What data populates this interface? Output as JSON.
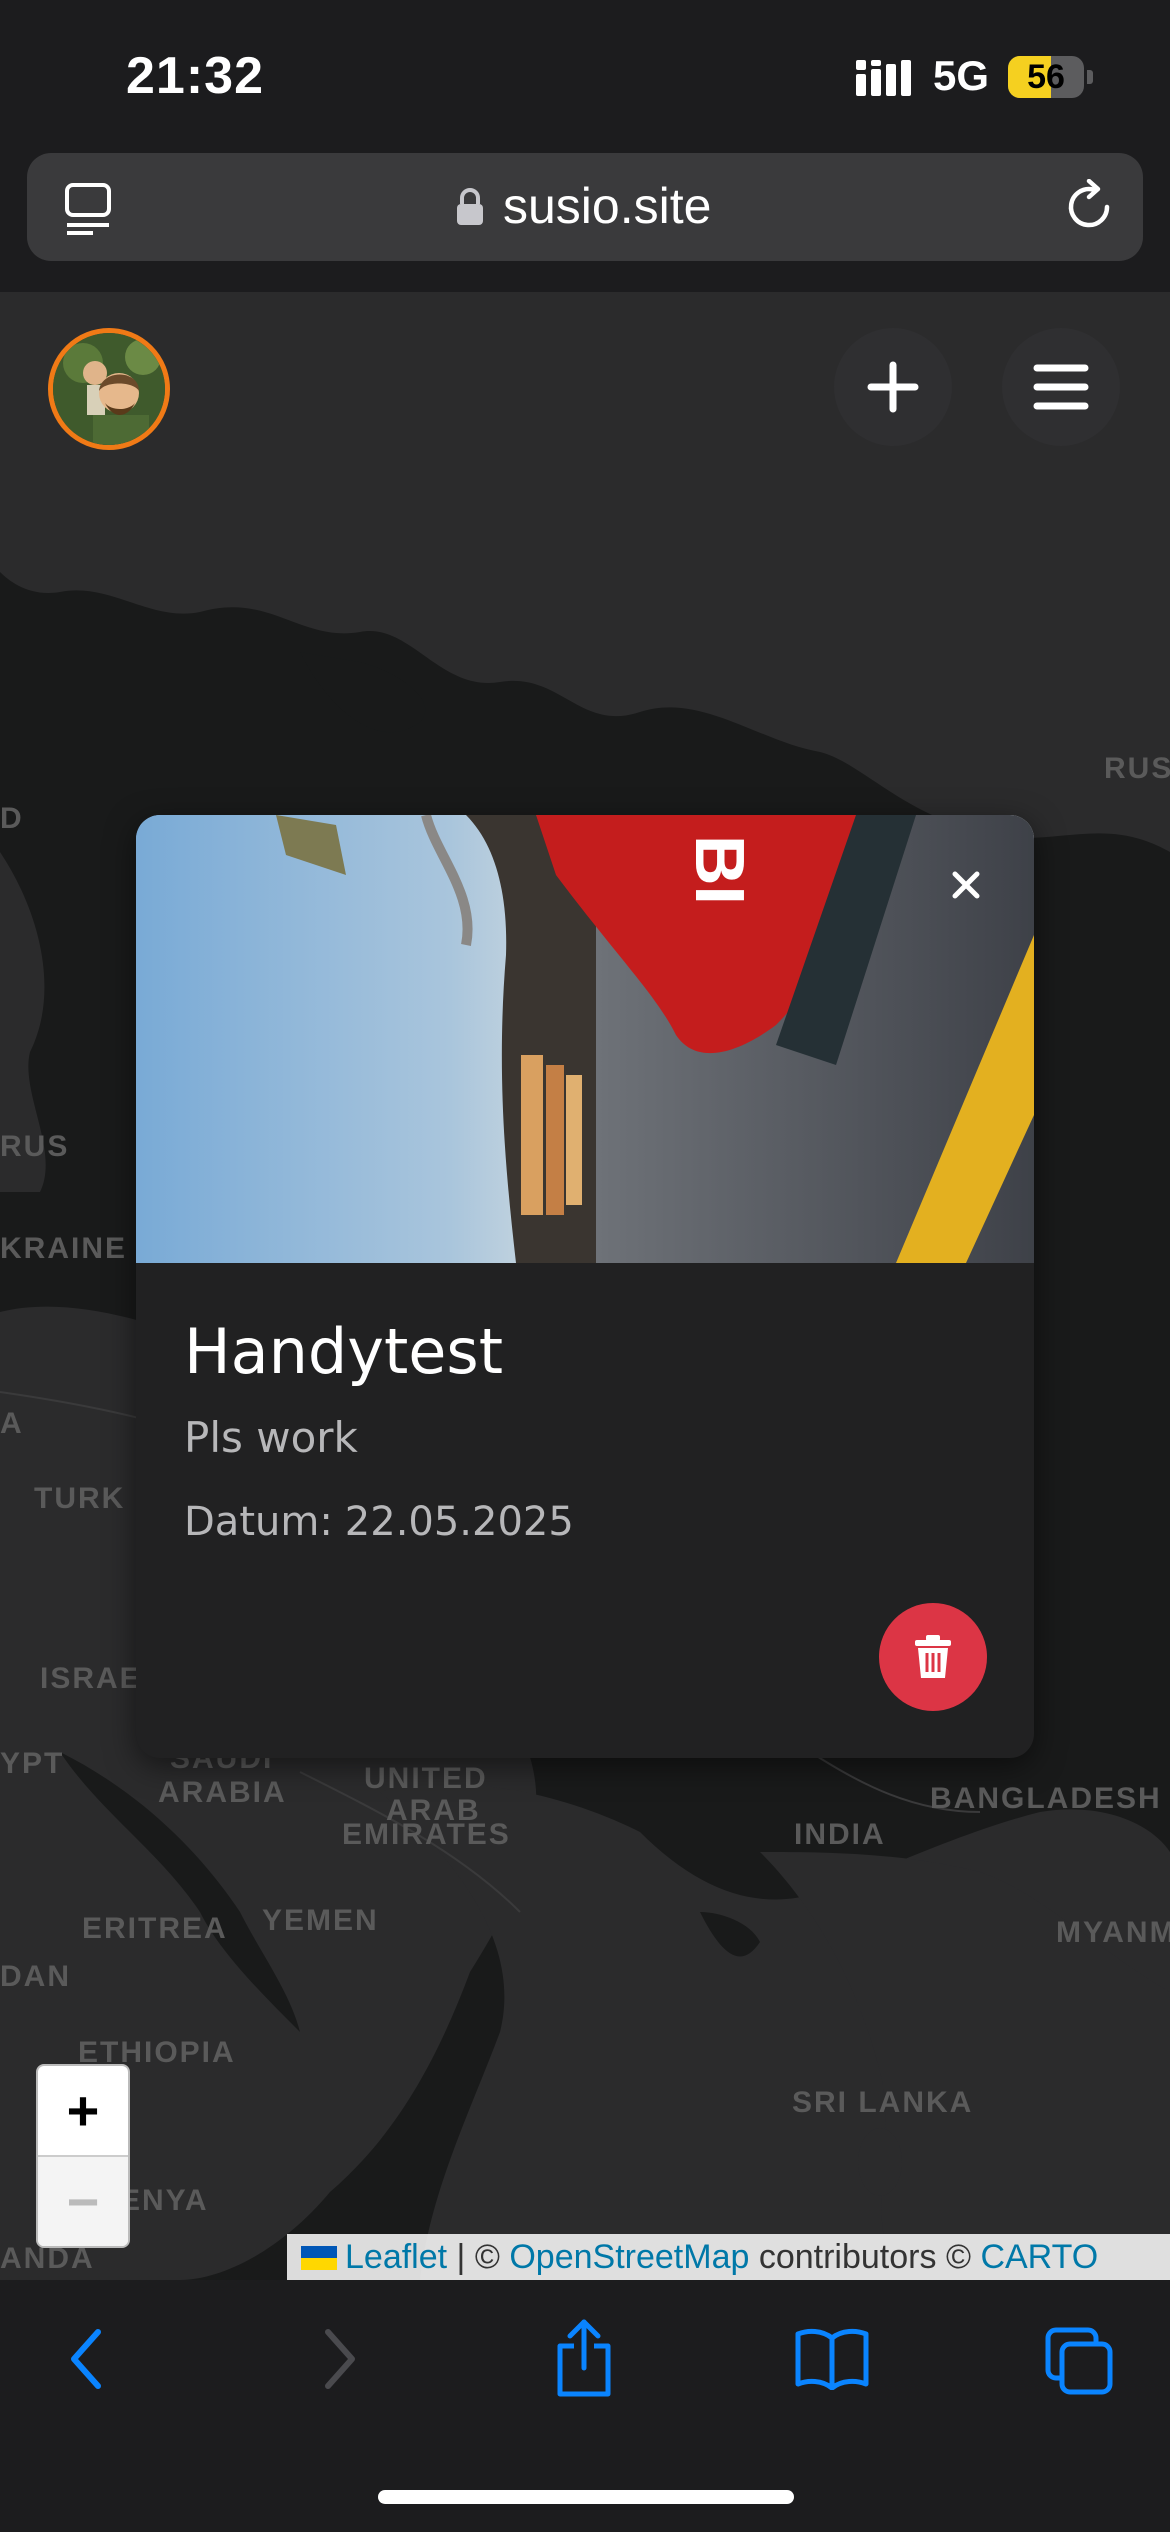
{
  "status_bar": {
    "time": "21:32",
    "network": "5G",
    "battery": "56",
    "battery_level": 0.56
  },
  "browser": {
    "url": "susio.site"
  },
  "map_labels": [
    "RUS",
    "RUS",
    "KRAINE",
    "TURK",
    "ISRAE",
    "YPT",
    "SAUDI",
    "ARABIA",
    "UNITED",
    "ARAB",
    "EMIRATES",
    "INDIA",
    "BANGLADESH",
    "MYANM",
    "DAN",
    "ERITREA",
    "YEMEN",
    "ETHIOPIA",
    "SRI LANKA",
    "ENYA",
    "ANDA",
    "A",
    "D"
  ],
  "popup": {
    "title": "Handytest",
    "description": "Pls work",
    "date_label": "Datum:",
    "date_value": "22.05.2025",
    "close_label": "×"
  },
  "zoom": {
    "in": "+",
    "out": "−"
  },
  "attribution": {
    "leaflet": "Leaflet",
    "sep1": "|",
    "copy1": "©",
    "osm": "OpenStreetMap",
    "contributors": "contributors",
    "copy2": "©",
    "carto": "CARTO"
  },
  "colors": {
    "accent": "#0a84ff",
    "delete": "#dc3545",
    "avatar_border": "#f07a16"
  },
  "icons": [
    "tabs-icon",
    "lock-icon",
    "reload-icon",
    "plus-icon",
    "menu-icon",
    "close-icon",
    "trash-icon",
    "back-icon",
    "forward-icon",
    "share-icon",
    "bookmarks-icon",
    "tabs-overview-icon"
  ]
}
